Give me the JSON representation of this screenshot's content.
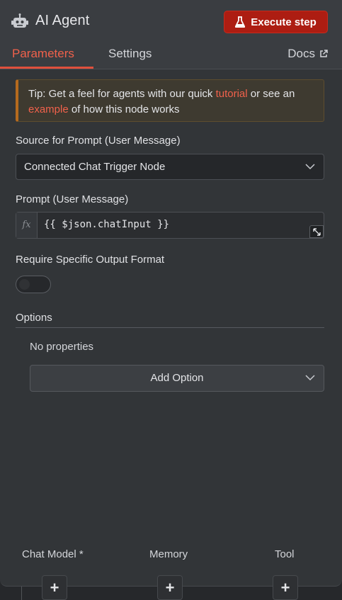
{
  "header": {
    "title": "AI Agent",
    "execute_label": "Execute step",
    "title_icon": "robot-icon",
    "execute_icon": "beaker-icon",
    "accent_color": "#ad1d12"
  },
  "tabs": {
    "parameters": "Parameters",
    "settings": "Settings",
    "docs": "Docs",
    "active": "Parameters"
  },
  "tip": {
    "prefix": "Tip: Get a feel for agents with our quick ",
    "link1": "tutorial",
    "middle": " or see an ",
    "link2": "example",
    "suffix": " of how this node works"
  },
  "source": {
    "label": "Source for Prompt (User Message)",
    "value": "Connected Chat Trigger Node"
  },
  "prompt": {
    "label": "Prompt (User Message)",
    "fx": "fx",
    "value": "{{ $json.chatInput }}"
  },
  "output_format": {
    "label": "Require Specific Output Format",
    "enabled": false
  },
  "options": {
    "title": "Options",
    "empty_text": "No properties",
    "add_label": "Add Option"
  },
  "subnodes": [
    {
      "label": "Chat Model *"
    },
    {
      "label": "Memory"
    },
    {
      "label": "Tool"
    }
  ]
}
